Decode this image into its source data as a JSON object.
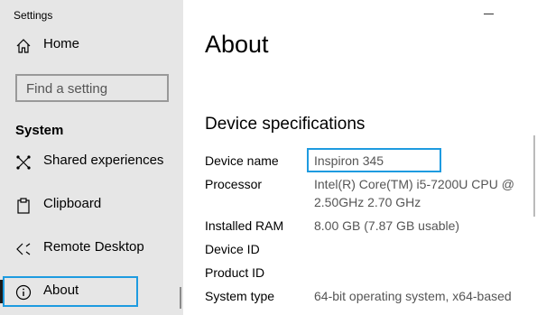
{
  "window": {
    "title": "Settings"
  },
  "sidebar": {
    "home_label": "Home",
    "search_placeholder": "Find a setting",
    "section_title": "System",
    "items": [
      {
        "label": "Shared experiences",
        "icon": "shared-experiences-icon"
      },
      {
        "label": "Clipboard",
        "icon": "clipboard-icon"
      },
      {
        "label": "Remote Desktop",
        "icon": "remote-desktop-icon"
      },
      {
        "label": "About",
        "icon": "info-icon",
        "selected": true
      }
    ]
  },
  "main": {
    "title": "About",
    "section_title": "Device specifications",
    "specs": [
      {
        "label": "Device name",
        "value": "Inspiron 345"
      },
      {
        "label": "Processor",
        "value": "Intel(R) Core(TM) i5-7200U CPU @",
        "value2": "2.50GHz   2.70 GHz"
      },
      {
        "label": "Installed RAM",
        "value": "8.00 GB (7.87 GB usable)"
      },
      {
        "label": "Device ID",
        "value": ""
      },
      {
        "label": "Product ID",
        "value": ""
      },
      {
        "label": "System type",
        "value": "64-bit operating system, x64-based"
      }
    ]
  },
  "colors": {
    "highlight": "#1e9be0",
    "sidebar_bg": "#e6e6e6"
  }
}
